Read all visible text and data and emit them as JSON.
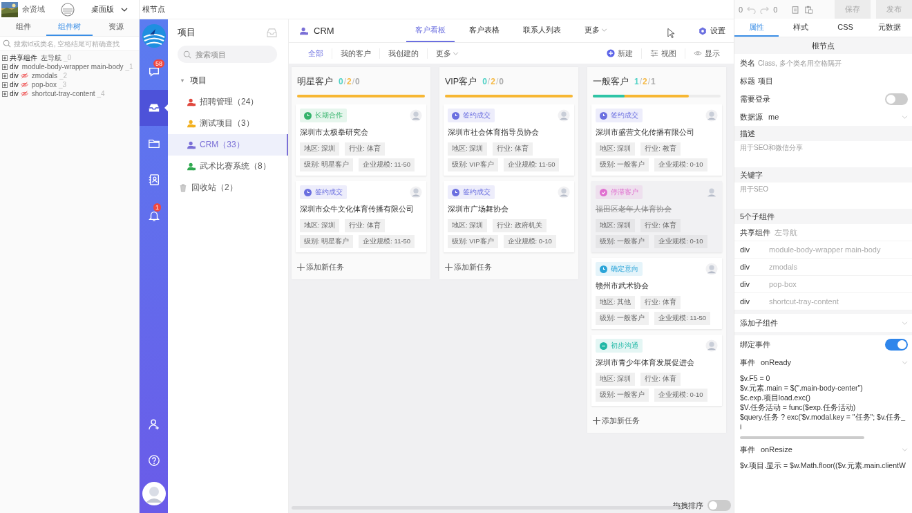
{
  "top_left": {
    "user_name": "余贤域",
    "mode_select": "桌面版"
  },
  "breadcrumb": "根节点",
  "left_tabs": [
    {
      "label": "组件",
      "selected": false
    },
    {
      "label": "组件树",
      "selected": true
    },
    {
      "label": "资源",
      "selected": false
    }
  ],
  "tree_search": {
    "placeholder": "搜索id或类名, 空格结尾可精确查找"
  },
  "tree": [
    {
      "tag": "共享组件",
      "hidden": false,
      "name": "左导航",
      "index": "_0"
    },
    {
      "tag": "div",
      "hidden": false,
      "name": "module-body-wrapper main-body",
      "index": "_1"
    },
    {
      "tag": "div",
      "hidden": true,
      "name": "zmodals",
      "index": "_2"
    },
    {
      "tag": "div",
      "hidden": true,
      "name": "pop-box",
      "index": "_3"
    },
    {
      "tag": "div",
      "hidden": true,
      "name": "shortcut-tray-content",
      "index": "_4"
    }
  ],
  "rail": {
    "items": [
      {
        "kind": "chat",
        "badge": "58",
        "selected": false
      },
      {
        "kind": "inbox",
        "selected": true
      },
      {
        "kind": "folder",
        "selected": false
      },
      {
        "kind": "contacts",
        "selected": false
      },
      {
        "kind": "bell",
        "badge": "1",
        "selected": false
      }
    ],
    "bottom": [
      {
        "kind": "user-add"
      },
      {
        "kind": "help"
      }
    ]
  },
  "projects": {
    "title": "项目",
    "search": {
      "placeholder": "搜索项目"
    },
    "group": {
      "label": "项目",
      "expanded": true,
      "children": [
        {
          "label": "招聘管理（24）",
          "color": "#e0483e",
          "selected": false
        },
        {
          "label": "测试项目（3）",
          "color": "#f2b01e",
          "selected": false
        },
        {
          "label": "CRM（33）",
          "color": "#7a6fd6",
          "selected": true
        },
        {
          "label": "武术比赛系统（8）",
          "color": "#2fa84f",
          "selected": false
        }
      ]
    },
    "trash": "回收站（2）"
  },
  "header": {
    "title": "CRM",
    "tabs": [
      {
        "label": "客户看板",
        "selected": true,
        "menu": false
      },
      {
        "label": "客户表格",
        "selected": false,
        "menu": false
      },
      {
        "label": "联系人列表",
        "selected": false,
        "menu": false
      },
      {
        "label": "更多",
        "selected": false,
        "menu": true
      }
    ],
    "settings": "设置"
  },
  "filters": [
    {
      "label": "全部",
      "selected": true,
      "menu": false
    },
    {
      "label": "我的客户",
      "selected": false,
      "menu": false
    },
    {
      "label": "我创建的",
      "selected": false,
      "menu": false
    },
    {
      "label": "更多",
      "selected": false,
      "menu": true
    }
  ],
  "actions": [
    {
      "kind": "new",
      "label": "新建"
    },
    {
      "kind": "view",
      "label": "视图"
    },
    {
      "kind": "display",
      "label": "显示"
    }
  ],
  "columns": [
    {
      "title": "明星客户",
      "counts": [
        {
          "text": "0",
          "color": "#4fd1c5"
        },
        {
          "text": "2",
          "color": "#f5b946"
        },
        {
          "text": "0",
          "color": "#aaaaaa"
        }
      ],
      "separator": "/",
      "progress": [
        {
          "color": "#f7b733",
          "level": 1
        }
      ],
      "cards": [
        {
          "tag": {
            "label": "长期合作",
            "kind": "clock",
            "color": "#34b36b"
          },
          "name": "深圳市太极拳研究会",
          "closed": false,
          "fields": [
            "地区: 深圳",
            "行业: 体育",
            "级别: 明星客户",
            "企业规模: 11-50"
          ]
        },
        {
          "tag": {
            "label": "签约成交",
            "kind": "clock",
            "color": "#6b6fe0"
          },
          "name": "深圳市众牛文化体育传播有限公司",
          "closed": false,
          "fields": [
            "地区: 深圳",
            "行业: 体育",
            "级别: 明星客户",
            "企业规模: 11-50"
          ]
        }
      ],
      "add_label": "添加新任务"
    },
    {
      "title": "VIP客户",
      "counts": [
        {
          "text": "0",
          "color": "#4fd1c5"
        },
        {
          "text": "2",
          "color": "#f5b946"
        },
        {
          "text": "0",
          "color": "#aaaaaa"
        }
      ],
      "separator": "/",
      "progress": [
        {
          "color": "#f7b733",
          "level": 1
        }
      ],
      "cards": [
        {
          "tag": {
            "label": "签约成交",
            "kind": "clock",
            "color": "#6b6fe0"
          },
          "name": "深圳市社会体育指导员协会",
          "closed": false,
          "fields": [
            "地区: 深圳",
            "行业: 体育",
            "级别: VIP客户",
            "企业规模: 11-50"
          ]
        },
        {
          "tag": {
            "label": "签约成交",
            "kind": "clock",
            "color": "#6b6fe0"
          },
          "name": "深圳市广场舞协会",
          "closed": false,
          "fields": [
            "地区: 深圳",
            "行业: 政府机关",
            "级别: VIP客户",
            "企业规模: 0-10"
          ]
        }
      ],
      "add_label": "添加新任务"
    },
    {
      "title": "一般客户",
      "counts": [
        {
          "text": "1",
          "color": "#4fd1c5"
        },
        {
          "text": "2",
          "color": "#f5b946"
        },
        {
          "text": "1",
          "color": "#aaaaaa"
        }
      ],
      "separator": "/",
      "progress": [
        {
          "color": "#2ec4a6",
          "level": 0.25
        },
        {
          "color": "#f7b733",
          "level": 0.75
        }
      ],
      "cards": [
        {
          "tag": {
            "label": "签约成交",
            "kind": "clock",
            "color": "#6b6fe0"
          },
          "name": "深圳市盛营文化传播有限公司",
          "closed": false,
          "fields": [
            "地区: 深圳",
            "行业: 教育",
            "级别: 一般客户",
            "企业规模: 0-10"
          ]
        },
        {
          "tag": {
            "label": "停滞客户",
            "kind": "check",
            "color": "#e06fd0"
          },
          "name": "福田区老年人体育协会",
          "closed": true,
          "fields": [
            "地区: 深圳",
            "行业: 体育",
            "级别: 一般客户",
            "企业规模: 0-10"
          ]
        },
        {
          "tag": {
            "label": "确定意向",
            "kind": "clock",
            "color": "#2aa4d8"
          },
          "name": "赣州市武术协会",
          "closed": false,
          "fields": [
            "地区: 其他",
            "行业: 体育",
            "级别: 一般客户",
            "企业规模: 11-50"
          ]
        },
        {
          "tag": {
            "label": "初步沟通",
            "kind": "minus",
            "color": "#21b8a6"
          },
          "name": "深圳市青少年体育发展促进会",
          "closed": false,
          "fields": [
            "地区: 深圳",
            "行业: 体育",
            "级别: 一般客户",
            "企业规模: 0-10"
          ]
        }
      ],
      "add_label": "添加新任务"
    }
  ],
  "sort_toggle": {
    "label": "拖拽排序",
    "on": false
  },
  "toolbar": {
    "undo_count": "0",
    "redo_count": "0",
    "save": {
      "label": "保存",
      "disabled": true
    },
    "publish": {
      "label": "发布",
      "disabled": true
    }
  },
  "right_tabs": [
    {
      "label": "属性",
      "selected": true
    },
    {
      "label": "样式",
      "selected": false
    },
    {
      "label": "CSS",
      "selected": false
    },
    {
      "label": "元数据",
      "selected": false
    }
  ],
  "node_title": "根节点",
  "props": {
    "class_label": "类名",
    "class_placeholder": "Class, 多个类名用空格隔开",
    "title_label": "标题",
    "title_value": "项目",
    "login_label": "需要登录",
    "login_on": false,
    "source_label": "数据源",
    "source_value": "me",
    "desc_label": "描述",
    "desc_placeholder": "用于SEO和微信分享",
    "keywords_label": "关键字",
    "keywords_placeholder": "用于SEO"
  },
  "children_heading": "5个子组件",
  "children": [
    {
      "tag": "共享组件",
      "name": "左导航"
    },
    {
      "tag": "div",
      "name": "module-body-wrapper main-body"
    },
    {
      "tag": "div",
      "name": "zmodals"
    },
    {
      "tag": "div",
      "name": "pop-box"
    },
    {
      "tag": "div",
      "name": "shortcut-tray-content"
    }
  ],
  "add_child": "添加子组件",
  "events_label": "绑定事件",
  "events_on": true,
  "events": [
    {
      "label": "事件",
      "name": "onReady",
      "code": [
        "$v.F5 = 0",
        "$v.元素.main = $(\".main-body-center\")",
        "$c.exp.项目load.exc()",
        "$V.任务活动 = func($exp.任务活动)",
        "$query.任务 ? exc('$v.modal.key = \"任务\"; $v.任务_i"
      ]
    },
    {
      "label": "事件",
      "name": "onResize",
      "code": [
        "$v.项目.显示 = $w.Math.floor(($v.元素.main.clientW"
      ]
    }
  ]
}
